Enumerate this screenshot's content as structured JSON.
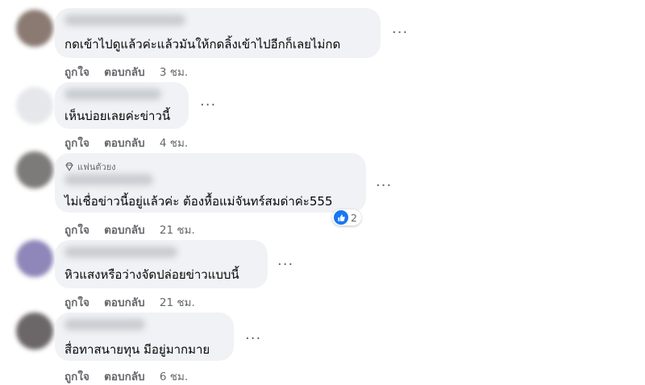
{
  "labels": {
    "like": "ถูกใจ",
    "reply": "ตอบกลับ"
  },
  "comments": [
    {
      "text": "กดเข้าไปดูแล้วค่ะแล้วมันให้กดลิ้งเข้าไปอีกก็เลยไม่กด",
      "time": "3 ชม.",
      "avatar_color": "#8a7a72"
    },
    {
      "text": "เห็นบ่อยเลยค่ะข่าวนี้",
      "time": "4 ชม.",
      "avatar_color": "#e6e7ea"
    },
    {
      "badge": "แฟนตัวยง",
      "text": "ไม่เชื่อข่าวนี้อยู่แล้วค่ะ ต้องหื้อแม่จันทร์สมด่าค่ะ555",
      "time": "21 ชม.",
      "reactions": "2",
      "avatar_color": "#7d7b79"
    },
    {
      "text": "หิวแสงหรือว่างจัดปล่อยข่าวแบบนี้",
      "time": "21 ชม.",
      "avatar_color": "#8f86b9"
    },
    {
      "text": "สื่อทาสนายทุน มีอยู่มากมาย",
      "time": "6 ชม.",
      "avatar_color": "#6b6667"
    }
  ],
  "more_label": "···"
}
